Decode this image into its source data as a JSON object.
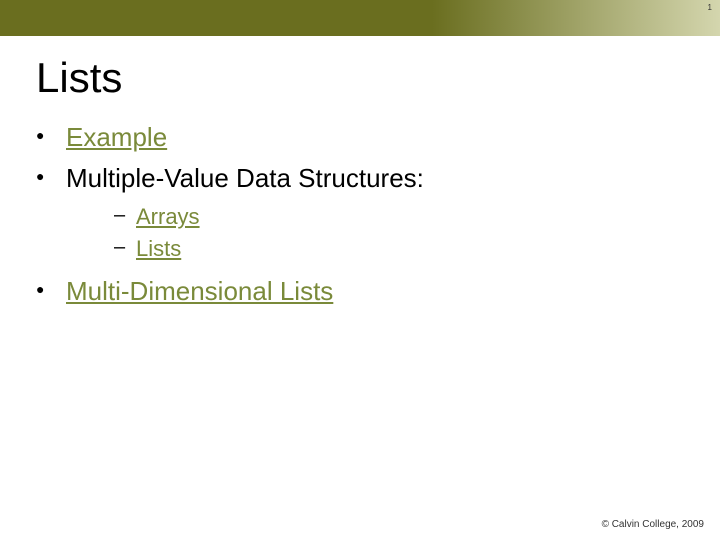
{
  "page_number": "1",
  "title": "Lists",
  "bullets": {
    "b1": {
      "text": "Example",
      "is_link": true
    },
    "b2": {
      "text": "Multiple-Value Data Structures:",
      "is_link": false
    },
    "b2_sub": {
      "s1": {
        "text": "Arrays",
        "is_link": true
      },
      "s2": {
        "text": "Lists",
        "is_link": true
      }
    },
    "b3": {
      "text": "Multi-Dimensional Lists",
      "is_link": true
    }
  },
  "footer": "© Calvin College, 2009"
}
